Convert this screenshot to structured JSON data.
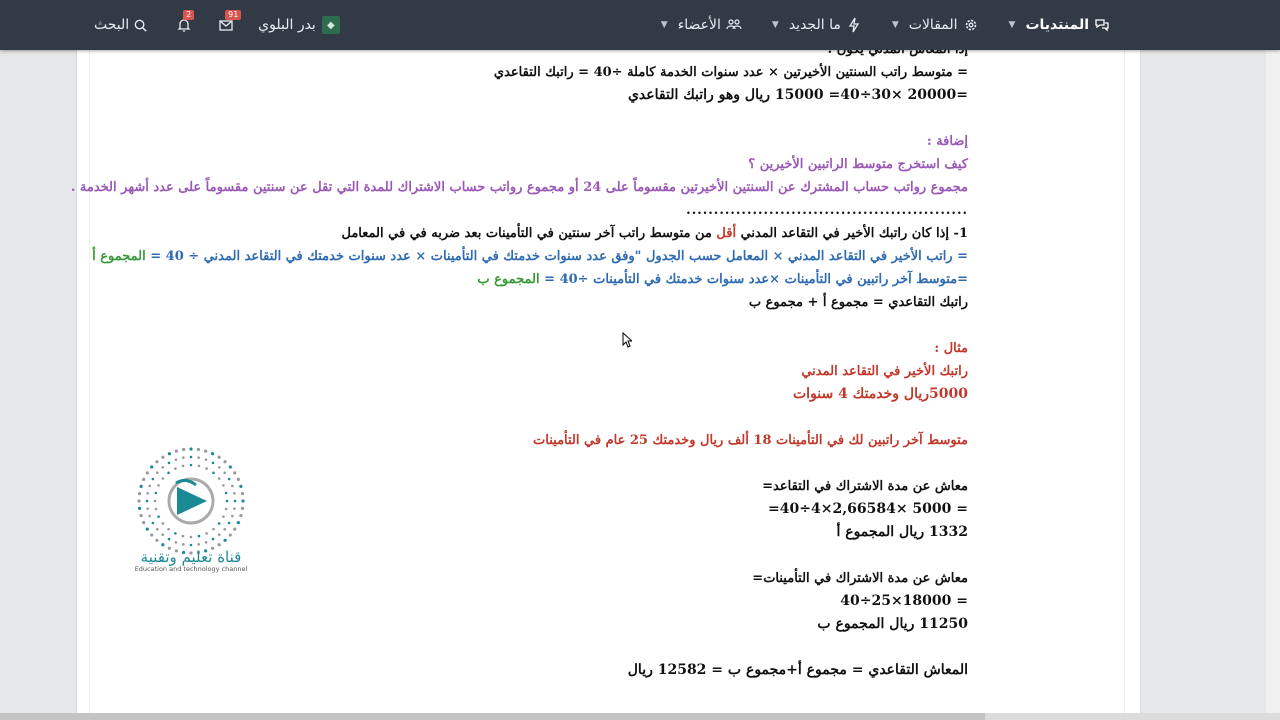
{
  "nav": {
    "forums": "المنتديات",
    "articles": "المقالات",
    "whats_new": "ما الجديد",
    "members": "الأعضاء",
    "user": "بدر البلوي",
    "inbox_count": "91",
    "alerts_count": "2",
    "search": "البحث"
  },
  "article": {
    "l0": "إذا المعاش المدني يكون :",
    "l1": "= متوسط راتب السنتين الأخيرتين × عدد سنوات الخدمة كاملة ÷40 = راتبك التقاعدي",
    "l2": "=20000 ×30÷40= 15000 ريال وهو راتبك التقاعدي",
    "l3": "إضافة :",
    "l4": "كيف استخرج متوسط الراتبين الأخيرين ؟",
    "l5": "مجموع رواتب حساب المشترك عن السنتين الأخيرتين مقسوماً على 24 أو مجموع رواتب حساب الاشتراك للمدة التي تقل عن سنتين مقسوماً على عدد أشهر الخدمة .",
    "l6": "................................................................................................................................................",
    "l7a": "1- إذا كان راتبك الأخير في التقاعد المدني ",
    "l7b": "أقل",
    "l7c": " من متوسط راتب آخر سنتين في التأمينات بعد ضربه في في المعامل",
    "l8a": "= راتب الأخير في التقاعد المدني × المعامل حسب الجدول \"وفق عدد سنوات خدمتك في التأمينات × عدد سنوات خدمتك في التقاعد المدني ÷ 40 = ",
    "l8b": "المجموع أ",
    "l9a": "=متوسط آخر راتبين في التأمينات ×عدد سنوات خدمتك في التأمينات ÷40 = ",
    "l9b": "المجموع ب",
    "l10": "راتبك التقاعدي = مجموع أ + مجموع ب",
    "l11": "مثال :",
    "l12": "راتبك الأخير في التقاعد المدني",
    "l13": "5000ريال وخدمتك 4 سنوات",
    "l14": "متوسط آخر راتبين لك في التأمينات 18 ألف ريال وخدمتك 25 عام في التأمينات",
    "l15": "معاش عن مدة الاشتراك في التقاعد=",
    "l16": "= 5000 ×2,66584×4÷40=",
    "l17": "1332 ريال المجموع أ",
    "l18": "معاش عن مدة الاشتراك في التأمينات=",
    "l19": "= 18000×25÷40",
    "l20": "11250 ريال المجموع ب",
    "l21": "المعاش التقاعدي = مجموع أ+مجموع ب = 12582 ريال"
  },
  "logo": {
    "arabic": "قناة تعليم وتقنية",
    "english": "Education and technology channel"
  },
  "colors": {
    "navbar": "#313a45",
    "purple": "#9b59b6",
    "blue": "#2e6bb1",
    "green": "#3a9a3a",
    "red": "#c0392b",
    "logo_teal": "#1b8a95"
  }
}
